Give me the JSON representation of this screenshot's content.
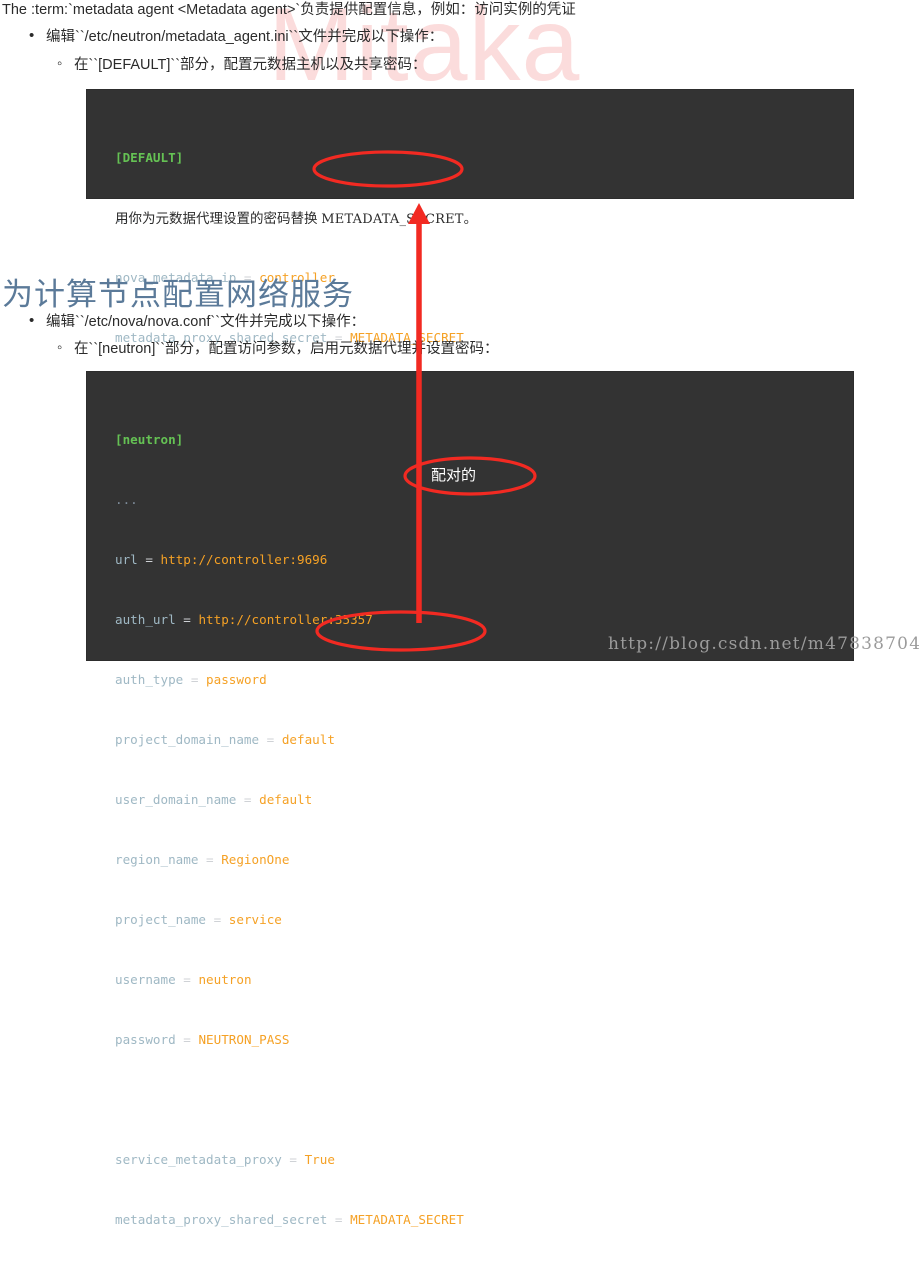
{
  "watermarks": {
    "background": "Mitaka",
    "footer_url": "http://blog.csdn.net/m47838704"
  },
  "document": {
    "lead_paragraph": "The :term:`metadata agent <Metadata agent>`负责提供配置信息，例如：访问实例的凭证",
    "bullets": [
      {
        "level": 1,
        "text": "编辑``/etc/neutron/metadata_agent.ini``文件并完成以下操作："
      },
      {
        "level": 2,
        "text": "在``[DEFAULT]``部分，配置元数据主机以及共享密码："
      },
      {
        "level": 1,
        "text": "编辑``/etc/nova/nova.conf``文件并完成以下操作："
      },
      {
        "level": 2,
        "text": "在``[neutron]``部分，配置访问参数，启用元数据代理并设置密码："
      }
    ],
    "note_prefix": "用你为元数据代理设置的密码替换 ",
    "note_mono": "METADATA_SECRET",
    "note_suffix": "。",
    "section_heading": "为计算节点配置网络服务"
  },
  "code_blocks": [
    {
      "id": "code-default",
      "section": "[DEFAULT]",
      "lines": [
        {
          "type": "section",
          "text": "[DEFAULT]"
        },
        {
          "type": "dots",
          "text": "..."
        },
        {
          "type": "kv",
          "key": "nova_metadata_ip",
          "op": "=",
          "value": "controller"
        },
        {
          "type": "kv",
          "key": "metadata_proxy_shared_secret",
          "op": "=",
          "value": "METADATA_SECRET"
        }
      ]
    },
    {
      "id": "code-neutron",
      "section": "[neutron]",
      "lines": [
        {
          "type": "section",
          "text": "[neutron]"
        },
        {
          "type": "dots",
          "text": "..."
        },
        {
          "type": "kv",
          "key": "url",
          "op": "=",
          "value": "http://controller:9696"
        },
        {
          "type": "kv",
          "key": "auth_url",
          "op": "=",
          "value": "http://controller:35357"
        },
        {
          "type": "kv",
          "key": "auth_type",
          "op": "=",
          "value": "password"
        },
        {
          "type": "kv",
          "key": "project_domain_name",
          "op": "=",
          "value": "default"
        },
        {
          "type": "kv",
          "key": "user_domain_name",
          "op": "=",
          "value": "default"
        },
        {
          "type": "kv",
          "key": "region_name",
          "op": "=",
          "value": "RegionOne"
        },
        {
          "type": "kv",
          "key": "project_name",
          "op": "=",
          "value": "service"
        },
        {
          "type": "kv",
          "key": "username",
          "op": "=",
          "value": "neutron"
        },
        {
          "type": "kv",
          "key": "password",
          "op": "=",
          "value": "NEUTRON_PASS"
        },
        {
          "type": "blank",
          "text": ""
        },
        {
          "type": "kv",
          "key": "service_metadata_proxy",
          "op": "=",
          "value": "True"
        },
        {
          "type": "kv",
          "key": "metadata_proxy_shared_secret",
          "op": "=",
          "value": "METADATA_SECRET"
        }
      ]
    }
  ],
  "annotations": {
    "pairing_label": "配对的",
    "ellipse_top_target": "METADATA_SECRET",
    "ellipse_bottom_target": "METADATA_SECRET",
    "arrow_direction": "up",
    "ink_color": "#f22a22"
  },
  "colors": {
    "code_background": "#333333",
    "section_token": "#65c254",
    "key_token": "#9fb8c4",
    "value_token": "#f5a125",
    "dots_token": "#7d8b99",
    "heading": "#5b7a99",
    "annotation_red": "#f22a22",
    "watermark_pink": "#fbdcdc",
    "footer_watermark": "#9b9b9b"
  }
}
